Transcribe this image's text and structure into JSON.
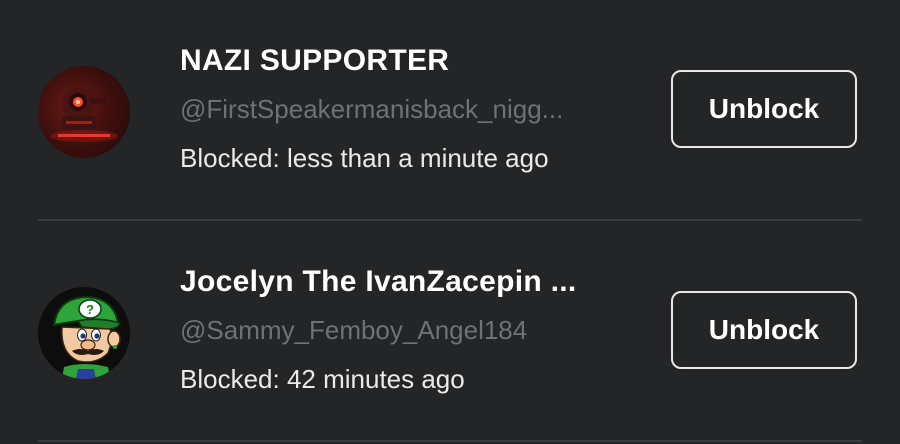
{
  "blocked_users": [
    {
      "display_name": "NAZI SUPPORTER",
      "username": "@FirstSpeakermanisback_nigg...",
      "blocked_text": "Blocked: less than a minute ago",
      "button_label": "Unblock",
      "avatar_icon": "red-robot-avatar-icon"
    },
    {
      "display_name": "Jocelyn The IvanZacepin ...",
      "username": "@Sammy_Femboy_Angel184",
      "blocked_text": "Blocked: 42 minutes ago",
      "button_label": "Unblock",
      "avatar_icon": "green-cap-character-avatar-icon"
    }
  ],
  "colors": {
    "background": "#232527",
    "username": "#6f7275",
    "divider": "#393b3d",
    "button_border": "#e8e8e8"
  }
}
